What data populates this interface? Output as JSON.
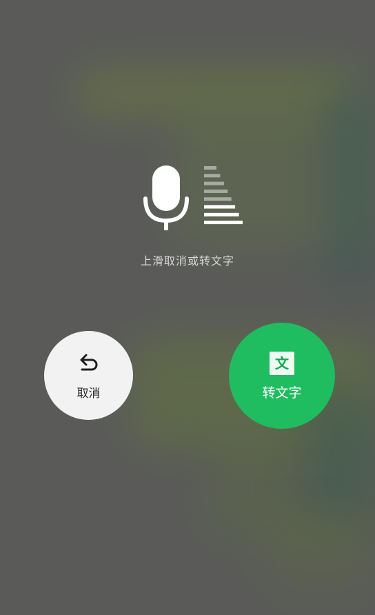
{
  "overlay": {
    "hint": "上滑取消或转文字",
    "volume_level": 3,
    "volume_max": 8
  },
  "cancel": {
    "label": "取消",
    "icon": "undo-arrow-icon"
  },
  "convert": {
    "label": "转文字",
    "icon_text": "文",
    "icon": "text-doc-icon",
    "color": "#1fbd5f"
  }
}
